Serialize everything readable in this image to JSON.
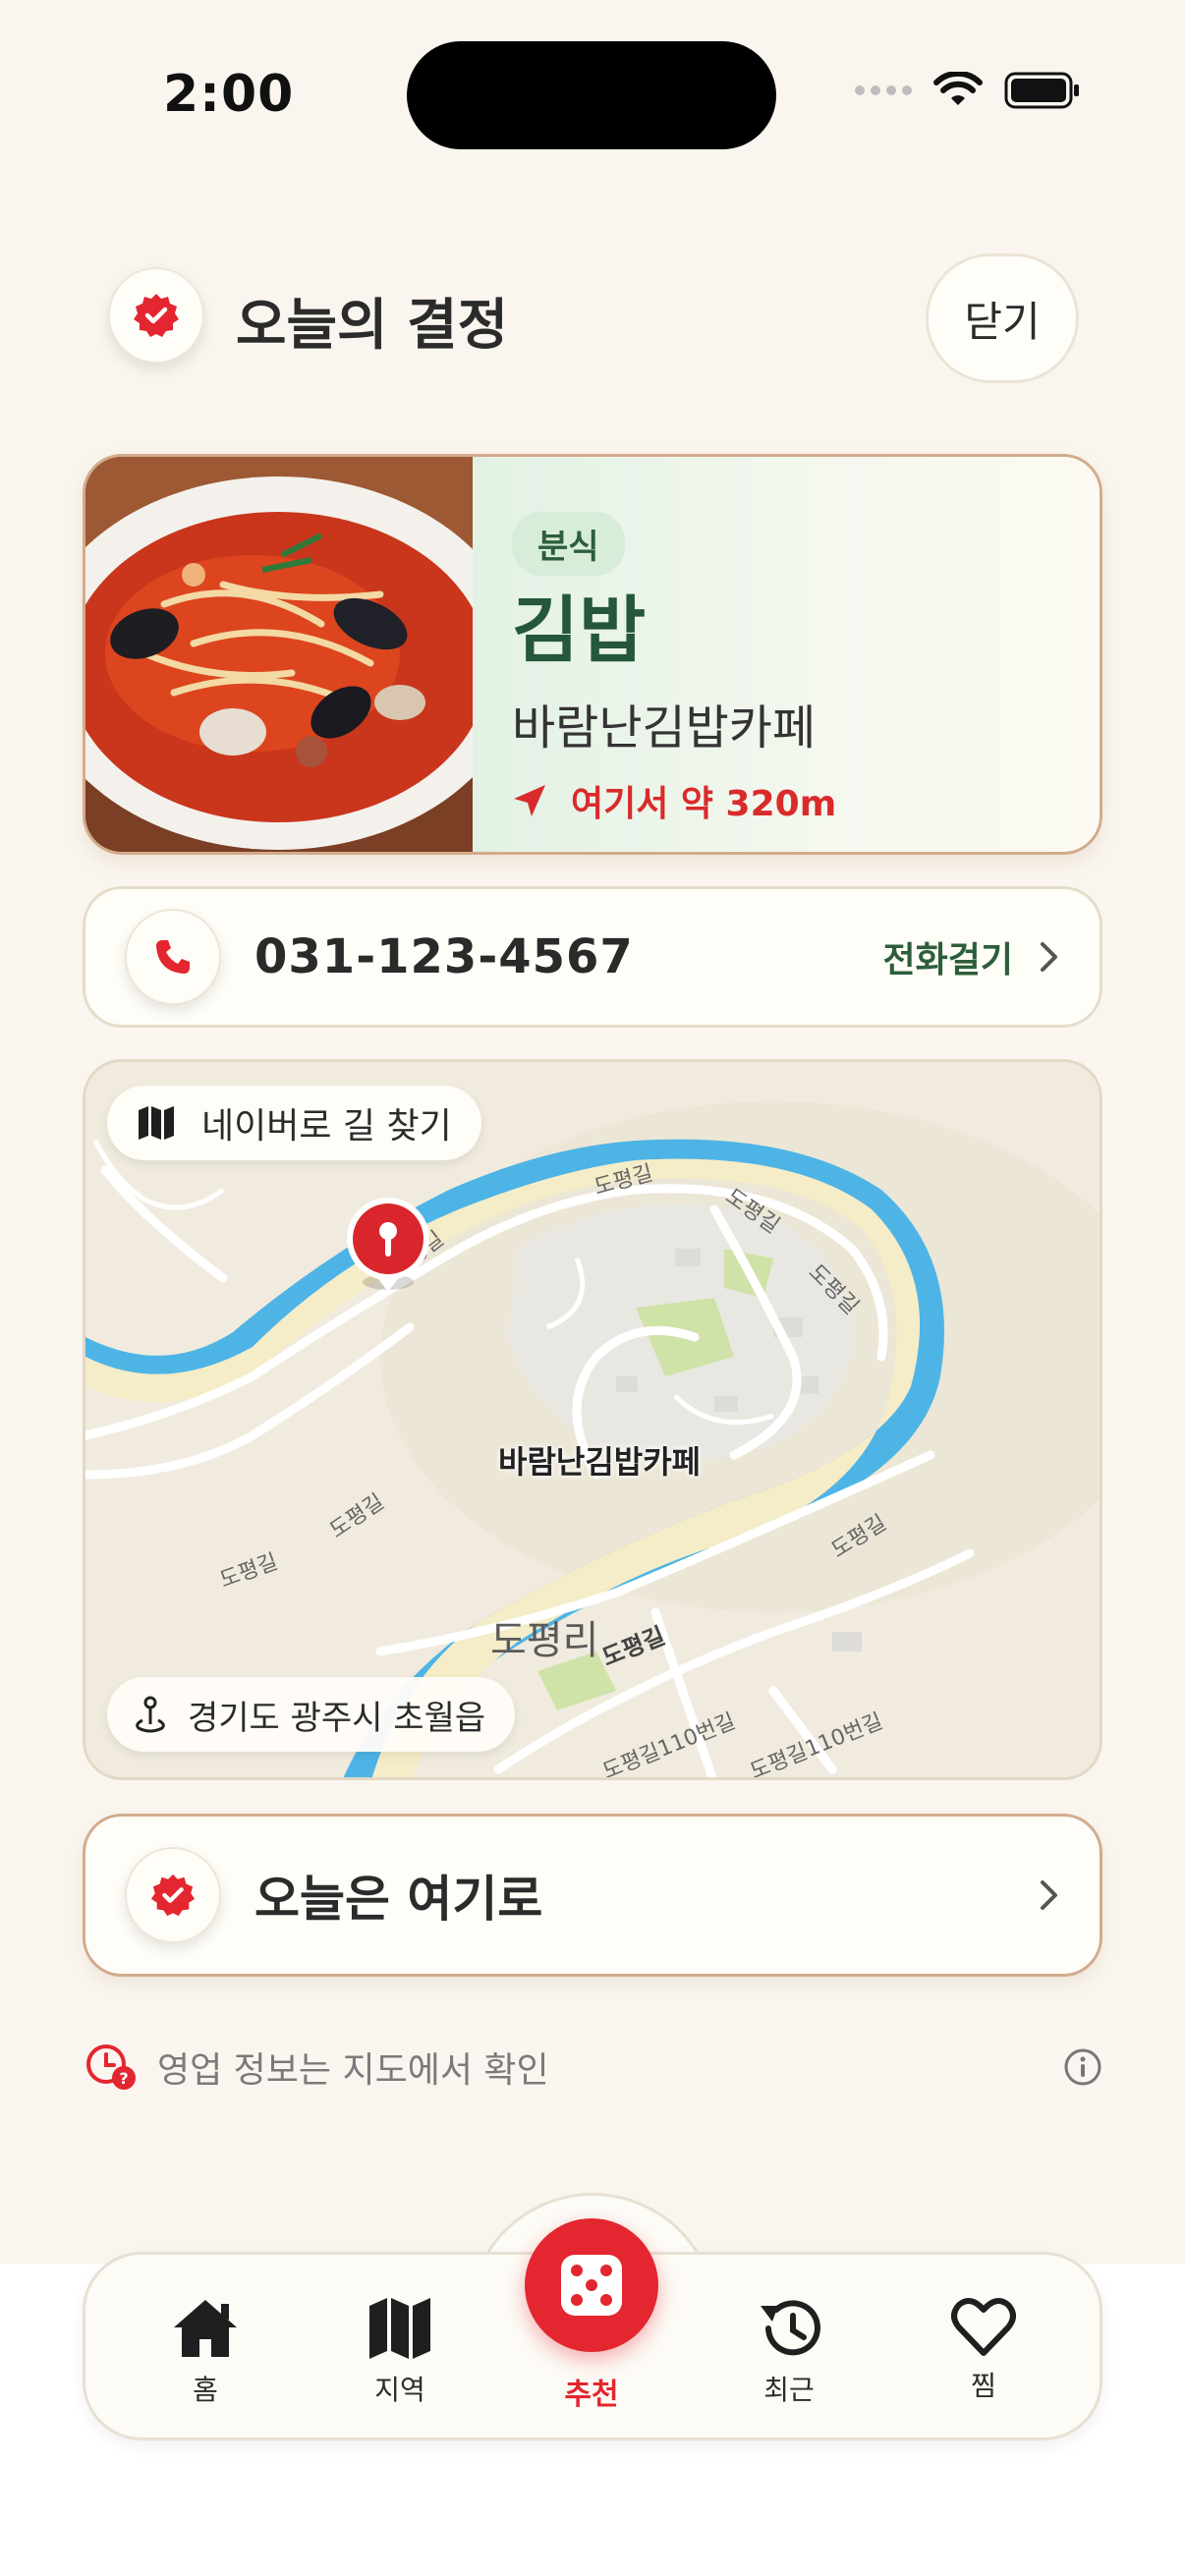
{
  "status_bar": {
    "time": "2:00"
  },
  "header": {
    "title": "오늘의 결정",
    "close_label": "닫기"
  },
  "restaurant": {
    "category": "분식",
    "menu": "김밥",
    "name": "바람난김밥카페",
    "distance": "여기서 약 320m"
  },
  "phone": {
    "number": "031-123-4567",
    "call_label": "전화걸기"
  },
  "map": {
    "nav_label": "네이버로 길 찾기",
    "pin_label": "바람난김밥카페",
    "area_label": "도평리",
    "address": "경기도 광주시 초월읍",
    "roads": [
      "도평길",
      "도평길",
      "도평길",
      "도평길",
      "도평길",
      "도평길",
      "도평길",
      "도평길110번길",
      "도평길110번길",
      "도평길"
    ]
  },
  "cta": {
    "label": "오늘은 여기로"
  },
  "info": {
    "text": "영업 정보는 지도에서 확인"
  },
  "tabs": [
    {
      "label": "홈",
      "icon": "house-icon"
    },
    {
      "label": "지역",
      "icon": "map-icon"
    },
    {
      "label": "추천",
      "icon": "dice-icon"
    },
    {
      "label": "최근",
      "icon": "history-icon"
    },
    {
      "label": "찜",
      "icon": "heart-icon"
    }
  ],
  "colors": {
    "accent_red": "#e3262f",
    "accent_green": "#2d5e3a",
    "background": "#faf6ef"
  }
}
